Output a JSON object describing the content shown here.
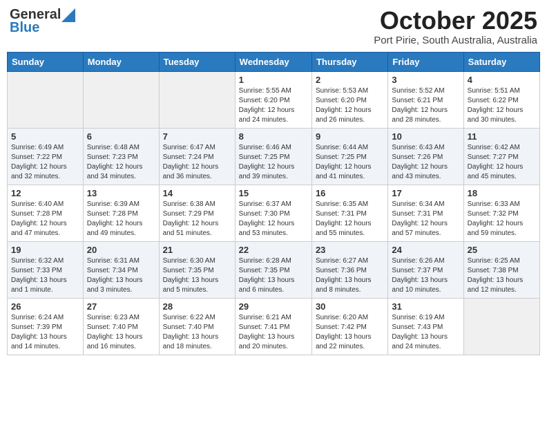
{
  "header": {
    "logo_general": "General",
    "logo_blue": "Blue",
    "month": "October 2025",
    "location": "Port Pirie, South Australia, Australia"
  },
  "days_of_week": [
    "Sunday",
    "Monday",
    "Tuesday",
    "Wednesday",
    "Thursday",
    "Friday",
    "Saturday"
  ],
  "weeks": [
    [
      {
        "day": "",
        "info": ""
      },
      {
        "day": "",
        "info": ""
      },
      {
        "day": "",
        "info": ""
      },
      {
        "day": "1",
        "info": "Sunrise: 5:55 AM\nSunset: 6:20 PM\nDaylight: 12 hours\nand 24 minutes."
      },
      {
        "day": "2",
        "info": "Sunrise: 5:53 AM\nSunset: 6:20 PM\nDaylight: 12 hours\nand 26 minutes."
      },
      {
        "day": "3",
        "info": "Sunrise: 5:52 AM\nSunset: 6:21 PM\nDaylight: 12 hours\nand 28 minutes."
      },
      {
        "day": "4",
        "info": "Sunrise: 5:51 AM\nSunset: 6:22 PM\nDaylight: 12 hours\nand 30 minutes."
      }
    ],
    [
      {
        "day": "5",
        "info": "Sunrise: 6:49 AM\nSunset: 7:22 PM\nDaylight: 12 hours\nand 32 minutes."
      },
      {
        "day": "6",
        "info": "Sunrise: 6:48 AM\nSunset: 7:23 PM\nDaylight: 12 hours\nand 34 minutes."
      },
      {
        "day": "7",
        "info": "Sunrise: 6:47 AM\nSunset: 7:24 PM\nDaylight: 12 hours\nand 36 minutes."
      },
      {
        "day": "8",
        "info": "Sunrise: 6:46 AM\nSunset: 7:25 PM\nDaylight: 12 hours\nand 39 minutes."
      },
      {
        "day": "9",
        "info": "Sunrise: 6:44 AM\nSunset: 7:25 PM\nDaylight: 12 hours\nand 41 minutes."
      },
      {
        "day": "10",
        "info": "Sunrise: 6:43 AM\nSunset: 7:26 PM\nDaylight: 12 hours\nand 43 minutes."
      },
      {
        "day": "11",
        "info": "Sunrise: 6:42 AM\nSunset: 7:27 PM\nDaylight: 12 hours\nand 45 minutes."
      }
    ],
    [
      {
        "day": "12",
        "info": "Sunrise: 6:40 AM\nSunset: 7:28 PM\nDaylight: 12 hours\nand 47 minutes."
      },
      {
        "day": "13",
        "info": "Sunrise: 6:39 AM\nSunset: 7:28 PM\nDaylight: 12 hours\nand 49 minutes."
      },
      {
        "day": "14",
        "info": "Sunrise: 6:38 AM\nSunset: 7:29 PM\nDaylight: 12 hours\nand 51 minutes."
      },
      {
        "day": "15",
        "info": "Sunrise: 6:37 AM\nSunset: 7:30 PM\nDaylight: 12 hours\nand 53 minutes."
      },
      {
        "day": "16",
        "info": "Sunrise: 6:35 AM\nSunset: 7:31 PM\nDaylight: 12 hours\nand 55 minutes."
      },
      {
        "day": "17",
        "info": "Sunrise: 6:34 AM\nSunset: 7:31 PM\nDaylight: 12 hours\nand 57 minutes."
      },
      {
        "day": "18",
        "info": "Sunrise: 6:33 AM\nSunset: 7:32 PM\nDaylight: 12 hours\nand 59 minutes."
      }
    ],
    [
      {
        "day": "19",
        "info": "Sunrise: 6:32 AM\nSunset: 7:33 PM\nDaylight: 13 hours\nand 1 minute."
      },
      {
        "day": "20",
        "info": "Sunrise: 6:31 AM\nSunset: 7:34 PM\nDaylight: 13 hours\nand 3 minutes."
      },
      {
        "day": "21",
        "info": "Sunrise: 6:30 AM\nSunset: 7:35 PM\nDaylight: 13 hours\nand 5 minutes."
      },
      {
        "day": "22",
        "info": "Sunrise: 6:28 AM\nSunset: 7:35 PM\nDaylight: 13 hours\nand 6 minutes."
      },
      {
        "day": "23",
        "info": "Sunrise: 6:27 AM\nSunset: 7:36 PM\nDaylight: 13 hours\nand 8 minutes."
      },
      {
        "day": "24",
        "info": "Sunrise: 6:26 AM\nSunset: 7:37 PM\nDaylight: 13 hours\nand 10 minutes."
      },
      {
        "day": "25",
        "info": "Sunrise: 6:25 AM\nSunset: 7:38 PM\nDaylight: 13 hours\nand 12 minutes."
      }
    ],
    [
      {
        "day": "26",
        "info": "Sunrise: 6:24 AM\nSunset: 7:39 PM\nDaylight: 13 hours\nand 14 minutes."
      },
      {
        "day": "27",
        "info": "Sunrise: 6:23 AM\nSunset: 7:40 PM\nDaylight: 13 hours\nand 16 minutes."
      },
      {
        "day": "28",
        "info": "Sunrise: 6:22 AM\nSunset: 7:40 PM\nDaylight: 13 hours\nand 18 minutes."
      },
      {
        "day": "29",
        "info": "Sunrise: 6:21 AM\nSunset: 7:41 PM\nDaylight: 13 hours\nand 20 minutes."
      },
      {
        "day": "30",
        "info": "Sunrise: 6:20 AM\nSunset: 7:42 PM\nDaylight: 13 hours\nand 22 minutes."
      },
      {
        "day": "31",
        "info": "Sunrise: 6:19 AM\nSunset: 7:43 PM\nDaylight: 13 hours\nand 24 minutes."
      },
      {
        "day": "",
        "info": ""
      }
    ]
  ]
}
